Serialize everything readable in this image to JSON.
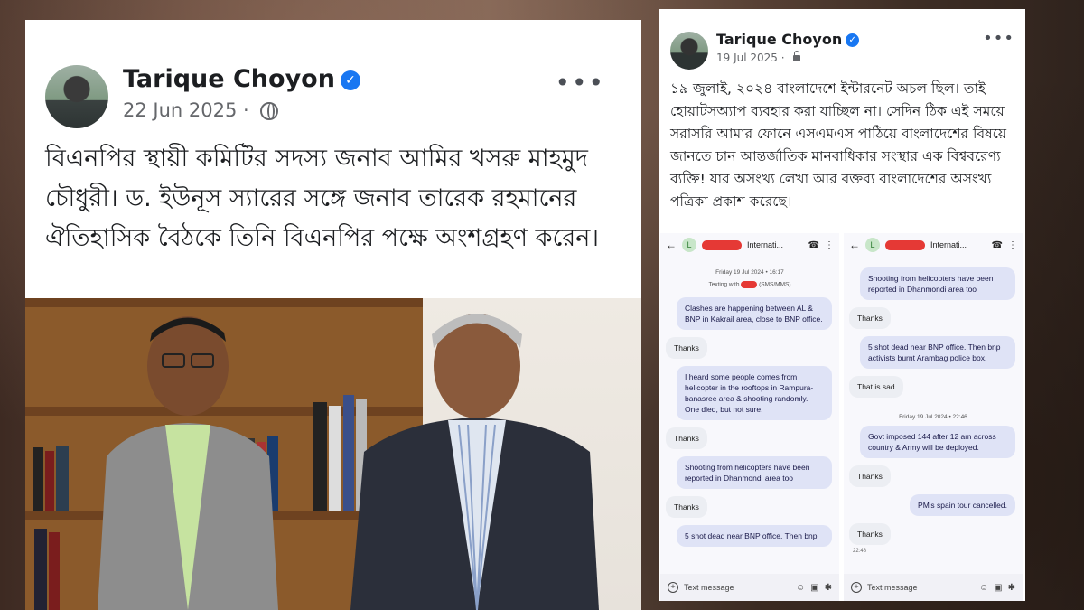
{
  "left_post": {
    "author": "Tarique Choyon",
    "date": "22 Jun 2025 ·",
    "body": "বিএনপির স্থায়ী কমিটির সদস্য জনাব আমির খসরু মাহমুদ চৌধুরী। ড. ইউনূস স্যারের সঙ্গে জনাব তারেক রহমানের ঐতিহাসিক বৈঠকে তিনি বিএনপির পক্ষে অংশগ্রহণ করেন।",
    "more": "•••"
  },
  "right_post": {
    "author": "Tarique Choyon",
    "date": "19 Jul 2025 ·",
    "body": "১৯ জুলাই, ২০২৪ বাংলাদেশে ইন্টারনেট অচল ছিল। তাই হোয়াটসঅ্যাপ ব্যবহার করা যাচ্ছিল না। সেদিন ঠিক এই সময়ে সরাসরি আমার ফোনে এসএমএস পাঠিয়ে বাংলাদেশের বিষয়ে জানতে চান আন্তর্জাতিক মানবাধিকার সংস্থার এক বিশ্ববরেণ্য ব্যক্তি! যার অসংখ্য লেখা আর বক্তব্য বাংলাদেশের অসংখ্য পত্রিকা প্রকাশ করেছে।",
    "more": "•••"
  },
  "phone1": {
    "avatar_letter": "L",
    "contact": "Internati...",
    "date_line": "Friday 19 Jul 2024 • 16:17",
    "system_prefix": "Texting with",
    "system_suffix": "(SMS/MMS)",
    "messages": [
      {
        "dir": "in",
        "text": "Clashes are happening between AL & BNP in Kakrail area, close to BNP office."
      },
      {
        "dir": "out",
        "text": "Thanks"
      },
      {
        "dir": "in",
        "text": "I heard some people comes from helicopter in the rooftops in Rampura-banasree area & shooting randomly. One died, but not sure."
      },
      {
        "dir": "out",
        "text": "Thanks"
      },
      {
        "dir": "in",
        "text": "Shooting from helicopters have been reported in Dhanmondi area too"
      },
      {
        "dir": "out",
        "text": "Thanks"
      },
      {
        "dir": "in",
        "text": "5 shot dead near BNP office. Then bnp"
      }
    ],
    "input_placeholder": "Text message"
  },
  "phone2": {
    "avatar_letter": "L",
    "contact": "Internati...",
    "messages_a": [
      {
        "dir": "in",
        "text": "Shooting from helicopters have been reported in Dhanmondi area too"
      },
      {
        "dir": "out",
        "text": "Thanks"
      },
      {
        "dir": "in",
        "text": "5 shot dead near BNP office. Then bnp activists burnt Arambag police box."
      },
      {
        "dir": "out",
        "text": "That is sad"
      }
    ],
    "date_line": "Friday 19 Jul 2024 • 22:46",
    "messages_b": [
      {
        "dir": "in",
        "text": "Govt imposed 144 after 12 am across country & Army will be deployed."
      },
      {
        "dir": "out",
        "text": "Thanks"
      },
      {
        "dir": "in",
        "text": "PM's spain tour cancelled."
      },
      {
        "dir": "out",
        "text": "Thanks"
      }
    ],
    "last_time": "22:48",
    "input_placeholder": "Text message"
  },
  "colors": {
    "verified": "#1877f2",
    "bubble_in": "#dfe3f6",
    "redaction": "#e53935"
  }
}
